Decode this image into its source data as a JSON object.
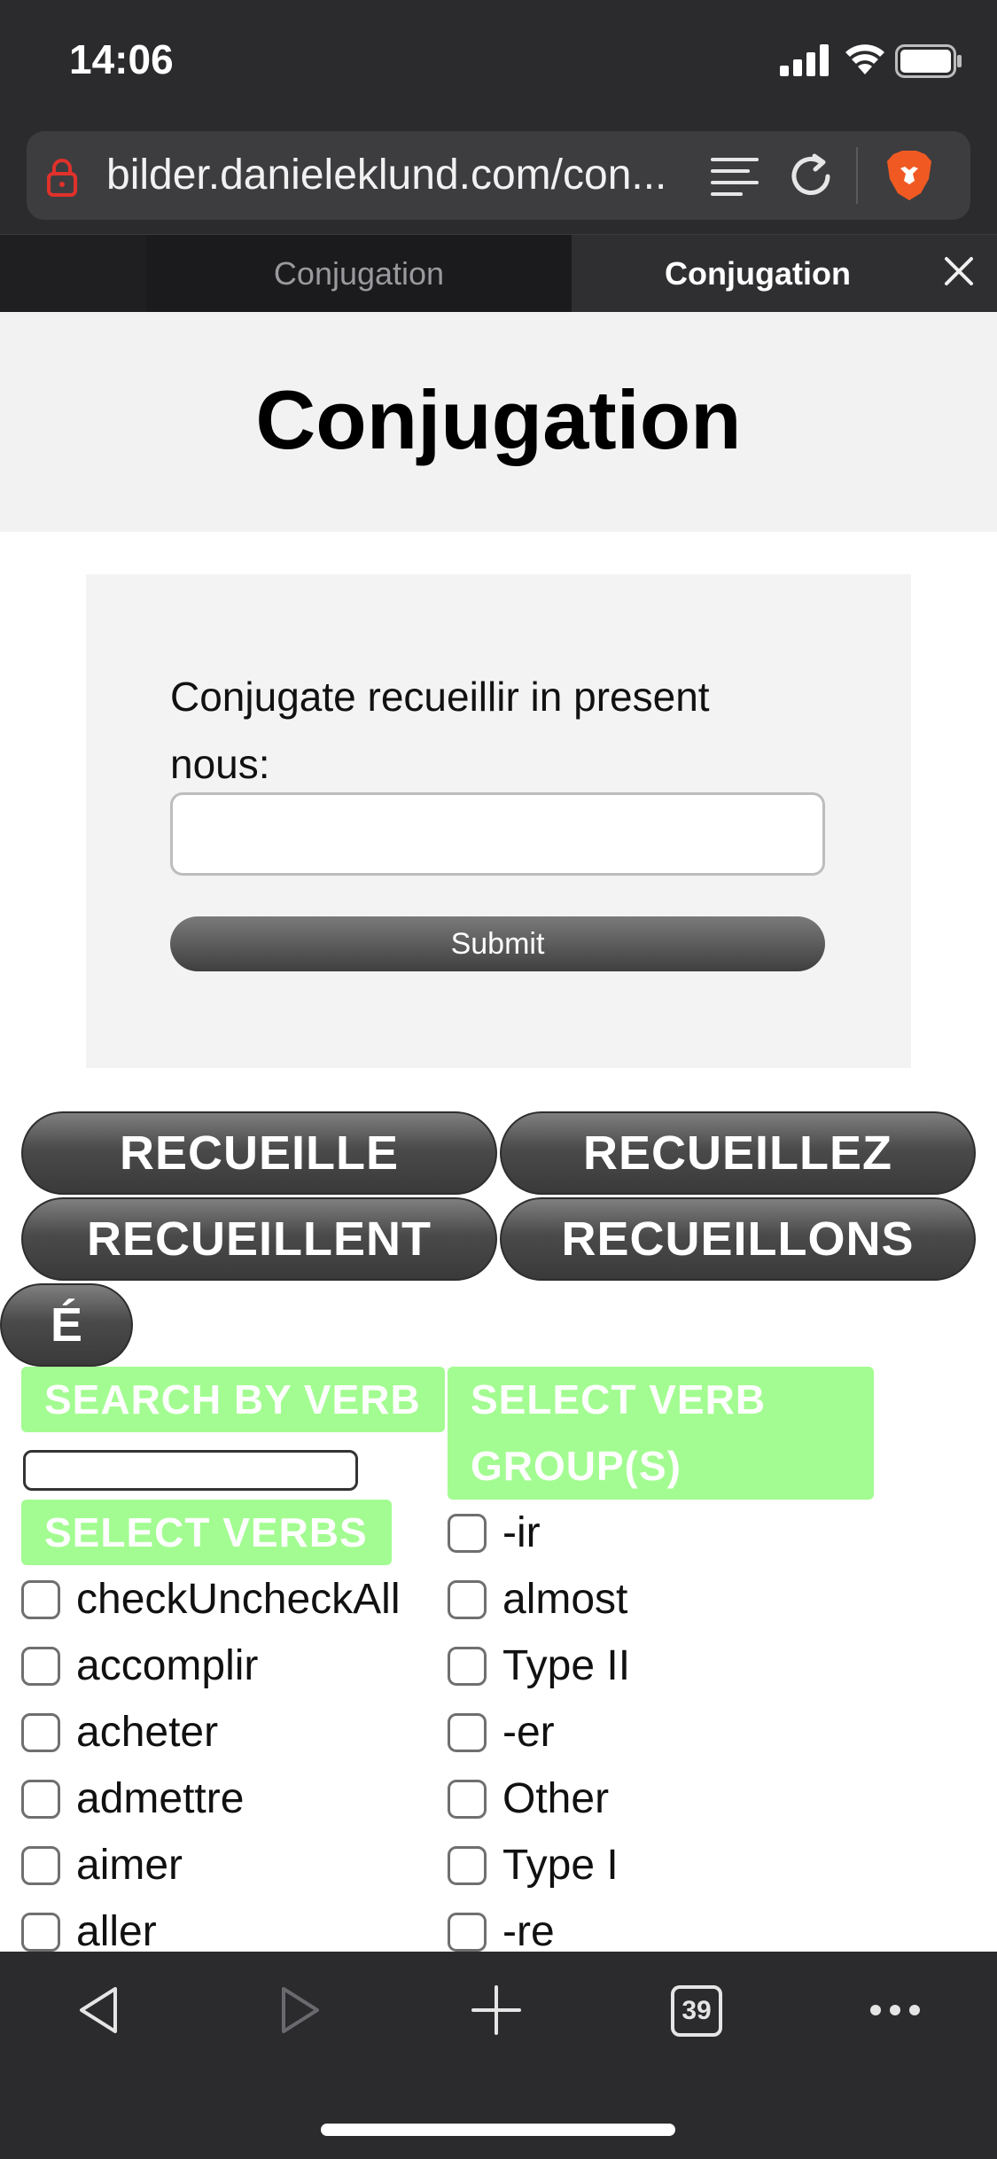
{
  "status": {
    "time": "14:06"
  },
  "browser": {
    "url": "bilder.danieleklund.com/con...",
    "tabs": [
      {
        "label": "Conjugation",
        "active": false
      },
      {
        "label": "Conjugation",
        "active": true
      }
    ],
    "tab_count": "39"
  },
  "page": {
    "title": "Conjugation",
    "prompt_line1": "Conjugate recueillir in present",
    "prompt_line2": "nous:",
    "answer_value": "",
    "submit_label": "Submit",
    "choices": [
      "RECUEILLE",
      "RECUEILLEZ",
      "RECUEILLENT",
      "RECUEILLONS"
    ],
    "accent_label": "É",
    "search_by_verb_label": "SEARCH BY VERB",
    "select_verb_group_label": "SELECT VERB GROUP(S)",
    "select_verbs_label": "SELECT VERBS",
    "verbs": [
      "checkUncheckAll",
      "accomplir",
      "acheter",
      "admettre",
      "aimer",
      "aller"
    ],
    "groups": [
      "-ir",
      "almost",
      "Type II",
      "-er",
      "Other",
      "Type I",
      "-re"
    ]
  },
  "colors": {
    "label_green": "#a3fc91",
    "browser_chrome": "#2b2b2d",
    "lock_red": "#e0312b"
  },
  "icons": [
    "lock-icon",
    "reader-mode-icon",
    "reload-icon",
    "brave-lion-icon",
    "close-tab-icon",
    "back-icon",
    "forward-icon",
    "new-tab-icon",
    "tabs-icon",
    "more-icon"
  ]
}
